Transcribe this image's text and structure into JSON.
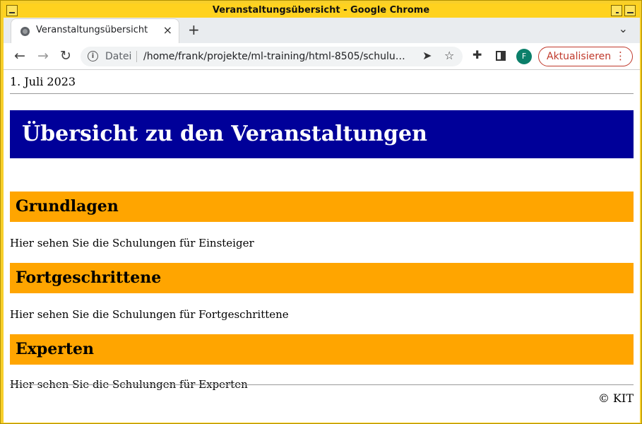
{
  "window": {
    "title": "Veranstaltungsübersicht - Google Chrome"
  },
  "browser": {
    "tab_title": "Veranstaltungsübersicht",
    "tab_close": "×",
    "new_tab": "+",
    "tab_menu": "⌄",
    "address_scheme": "Datei",
    "address_url": "/home/frank/projekte/ml-training/html-8505/schulu…",
    "avatar_letter": "F",
    "update_label": "Aktualisieren"
  },
  "page": {
    "date": "1. Juli 2023",
    "heading": "Übersicht zu den Veranstaltungen",
    "sections": [
      {
        "title": "Grundlagen",
        "text": "Hier sehen Sie die Schulungen für Einsteiger"
      },
      {
        "title": "Fortgeschrittene",
        "text": "Hier sehen Sie die Schulungen für Fortgeschrittene"
      },
      {
        "title": "Experten",
        "text": "Hier sehen Sie die Schulungen für Experten"
      }
    ],
    "footer": "© KIT"
  },
  "colors": {
    "banner_bg": "#000099",
    "section_bg": "#ffa500",
    "window_frame": "#ffd21f",
    "update_accent": "#c0392b"
  },
  "icons": [
    "globe-icon",
    "close-icon",
    "plus-icon",
    "chevron-down-icon",
    "back-arrow-icon",
    "forward-arrow-icon",
    "reload-icon",
    "info-icon",
    "send-icon",
    "star-icon",
    "puzzle-icon",
    "side-panel-icon",
    "more-vert-icon"
  ]
}
